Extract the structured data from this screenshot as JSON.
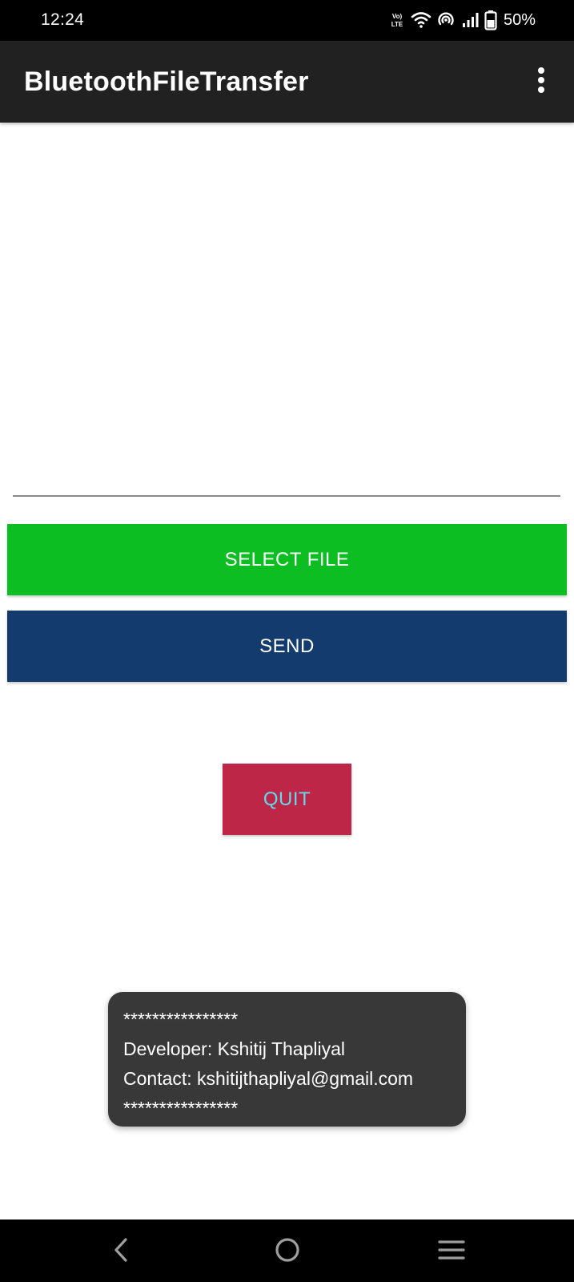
{
  "status_bar": {
    "time": "12:24",
    "lte_label": "LTE",
    "volte_label": "Vo)",
    "battery_percent": "50%",
    "icons": [
      "volte-lte-icon",
      "wifi-icon",
      "hotspot-icon",
      "signal-icon",
      "battery-icon"
    ]
  },
  "app_bar": {
    "title": "BluetoothFileTransfer",
    "overflow_icon": "more-vert-icon"
  },
  "file_field": {
    "value": ""
  },
  "buttons": {
    "select_file": "SELECT FILE",
    "send": "SEND",
    "quit": "QUIT"
  },
  "toast": {
    "line1": "****************",
    "line2": "Developer: Kshitij Thapliyal",
    "line3": "Contact: kshitijthapliyal@gmail.com",
    "line4": "****************"
  },
  "nav_bar": {
    "icons": [
      "back-icon",
      "home-icon",
      "recents-icon"
    ]
  },
  "colors": {
    "app_bar": "#212121",
    "select_file_button": "#0dbe22",
    "send_button": "#143b6e",
    "quit_button": "#bd2646",
    "quit_text": "#5fdcf0",
    "toast_background": "#383838"
  }
}
